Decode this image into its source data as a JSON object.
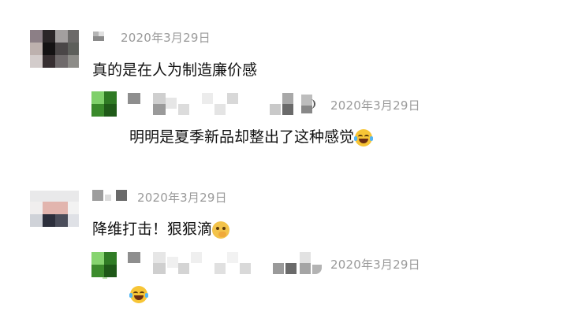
{
  "comments": [
    {
      "date": "2020年3月29日",
      "text": "真的是在人为制造廉价感",
      "reply": {
        "date": "2020年3月29日",
        "text": "明明是夏季新品却整出了这种感觉",
        "emoji": "face-with-tears-of-joy-icon"
      }
    },
    {
      "date": "2020年3月29日",
      "text": "降维打击！狠狠滴",
      "emoji": "face-with-hand-over-mouth-icon",
      "reply": {
        "date": "2020年3月29日",
        "text": "",
        "emoji": "face-with-tears-of-joy-icon"
      }
    }
  ],
  "colors": {
    "date": "#9a9a9a",
    "text": "#111111",
    "mosaic_green": "#3c8a2c"
  }
}
